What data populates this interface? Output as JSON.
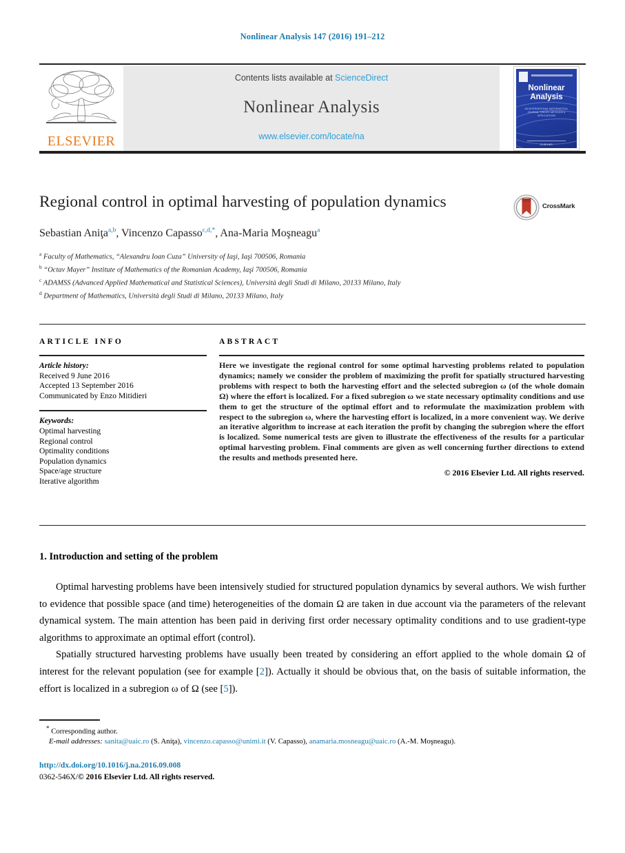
{
  "running_head": "Nonlinear Analysis 147 (2016) 191–212",
  "banner": {
    "contents_prefix": "Contents lists available at ",
    "sciencedirect": "ScienceDirect",
    "journal_name": "Nonlinear Analysis",
    "journal_url": "www.elsevier.com/locate/na",
    "publisher_wordmark": "ELSEVIER",
    "cover": {
      "title_line1": "Nonlinear",
      "title_line2": "Analysis",
      "subtitle": "AN INTERNATIONAL MATHEMATICAL JOURNAL THEORY METHODS & APPLICATIONS",
      "footer": "ELSEVIER"
    }
  },
  "article": {
    "title": "Regional control in optimal harvesting of population dynamics",
    "crossmark_label": "CrossMark",
    "authors_html": "Sebastian Aniţa<sup>a,b</sup>, Vincenzo Capasso<sup>c,d,</sup><sup>*</sup>, Ana-Maria Moşneagu<sup>a</sup>",
    "affiliations": [
      {
        "mark": "a",
        "text": "Faculty of Mathematics, “Alexandru Ioan Cuza” University of Iaşi, Iaşi 700506, Romania"
      },
      {
        "mark": "b",
        "text": "“Octav Mayer” Institute of Mathematics of the Romanian Academy, Iaşi 700506, Romania"
      },
      {
        "mark": "c",
        "text": "ADAMSS (Advanced Applied Mathematical and Statistical Sciences), Università degli Studi di Milano, 20133 Milano, Italy"
      },
      {
        "mark": "d",
        "text": "Department of Mathematics, Università degli Studi di Milano, 20133 Milano, Italy"
      }
    ]
  },
  "info": {
    "heading": "ARTICLE INFO",
    "history_label": "Article history:",
    "history": [
      "Received 9 June 2016",
      "Accepted 13 September 2016",
      "Communicated by Enzo Mitidieri"
    ],
    "keywords_label": "Keywords:",
    "keywords": [
      "Optimal harvesting",
      "Regional control",
      "Optimality conditions",
      "Population dynamics",
      "Space/age structure",
      "Iterative algorithm"
    ]
  },
  "abstract": {
    "heading": "ABSTRACT",
    "text": "Here we investigate the regional control for some optimal harvesting problems related to population dynamics; namely we consider the problem of maximizing the profit for spatially structured harvesting problems with respect to both the harvesting effort and the selected subregion ω (of the whole domain Ω) where the effort is localized. For a fixed subregion ω we state necessary optimality conditions and use them to get the structure of the optimal effort and to reformulate the maximization problem with respect to the subregion ω, where the harvesting effort is localized, in a more convenient way. We derive an iterative algorithm to increase at each iteration the profit by changing the subregion where the effort is localized. Some numerical tests are given to illustrate the effectiveness of the results for a particular optimal harvesting problem. Final comments are given as well concerning further directions to extend the results and methods presented here.",
    "copyright": "© 2016 Elsevier Ltd. All rights reserved."
  },
  "body": {
    "section_heading": "1. Introduction and setting of the problem",
    "paragraph1_a": "Optimal harvesting problems have been intensively studied for structured population dynamics by several authors. We wish further to evidence that possible space (and time) heterogeneities of the domain Ω are taken in due account via the parameters of the relevant dynamical system. The main attention has been paid in deriving first order necessary optimality conditions and to use gradient-type algorithms to approximate an optimal effort (control).",
    "paragraph2_a": "Spatially structured harvesting problems have usually been treated by considering an effort applied to the whole domain Ω of interest for the relevant population (see for example [",
    "paragraph2_ref1": "2",
    "paragraph2_b": "]). Actually it should be obvious that, on the basis of suitable information, the effort is localized in a subregion ω of Ω (see [",
    "paragraph2_ref2": "5",
    "paragraph2_c": "])."
  },
  "footnotes": {
    "corresponding": "Corresponding author.",
    "email_label": "E-mail addresses:",
    "emails": [
      {
        "address": "sanita@uaic.ro",
        "owner": "(S. Aniţa)"
      },
      {
        "address": "vincenzo.capasso@unimi.it",
        "owner": "(V. Capasso)"
      },
      {
        "address": "anamaria.mosneagu@uaic.ro",
        "owner": "(A.-M. Moşneagu)"
      }
    ],
    "doi": "http://dx.doi.org/10.1016/j.na.2016.09.008",
    "issn_prefix": "0362-546X/",
    "issn_copyright": "© 2016 Elsevier Ltd. All rights reserved."
  },
  "colors": {
    "link": "#1a7bad",
    "sciencedirect": "#2a9fd8",
    "elsevier_orange": "#e87b1e",
    "cover_blue": "#2340a8"
  }
}
